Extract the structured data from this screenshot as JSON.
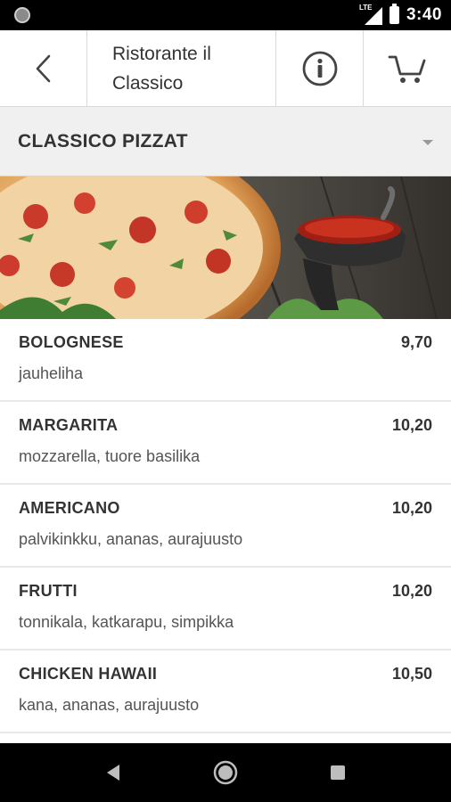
{
  "status_bar": {
    "time": "3:40",
    "network_label": "LTE",
    "icons": [
      "notification-icon",
      "signal-icon",
      "battery-icon"
    ]
  },
  "app_bar": {
    "title": "Ristorante il Classico",
    "back_icon": "chevron-left-icon",
    "info_icon": "info-icon",
    "cart_icon": "cart-icon"
  },
  "category": {
    "label": "CLASSICO PIZZAT",
    "dropdown_icon": "caret-down-icon"
  },
  "banner": {
    "image": "pizza-and-sauce-photo"
  },
  "menu_items": [
    {
      "name": "BOLOGNESE",
      "price": "9,70",
      "description": "jauheliha"
    },
    {
      "name": "MARGARITA",
      "price": "10,20",
      "description": "mozzarella, tuore basilika"
    },
    {
      "name": "AMERICANO",
      "price": "10,20",
      "description": "palvikinkku, ananas, aurajuusto"
    },
    {
      "name": "FRUTTI",
      "price": "10,20",
      "description": "tonnikala, katkarapu, simpikka"
    },
    {
      "name": "CHICKEN HAWAII",
      "price": "10,50",
      "description": "kana, ananas, aurajuusto"
    }
  ],
  "nav_bar": {
    "icons": [
      "back-triangle-icon",
      "home-circle-icon",
      "recents-square-icon"
    ]
  },
  "colors": {
    "status_bar_bg": "#000000",
    "category_bg": "#f0f0f0",
    "divider": "#e8e8e8",
    "text_dark": "#333333"
  }
}
